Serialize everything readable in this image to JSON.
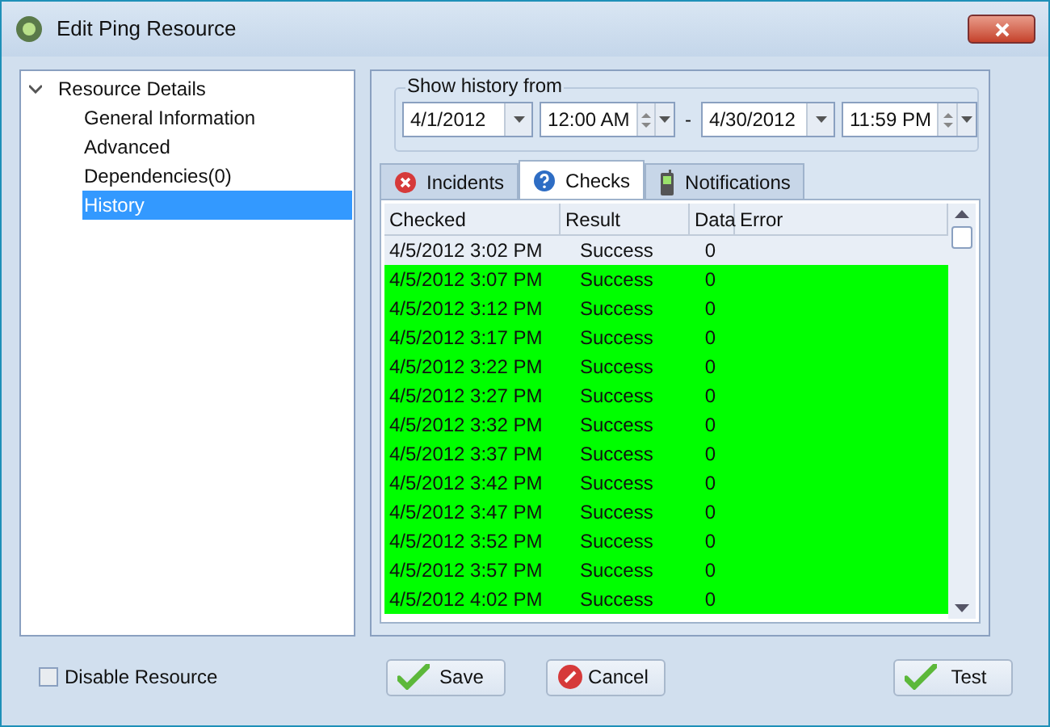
{
  "window": {
    "title": "Edit Ping Resource"
  },
  "tree": {
    "label": "Resource Details",
    "expanded": true,
    "children": [
      {
        "label": "General Information",
        "selected": false
      },
      {
        "label": "Advanced",
        "selected": false
      },
      {
        "label": "Dependencies(0)",
        "selected": false
      },
      {
        "label": "History",
        "selected": true
      }
    ]
  },
  "history_filter": {
    "title": "Show history from",
    "from_date": "4/1/2012",
    "from_time": "12:00 AM",
    "separator": "-",
    "to_date": "4/30/2012",
    "to_time": "11:59 PM"
  },
  "tabs": [
    {
      "label": "Incidents",
      "kind": "error",
      "selected": false
    },
    {
      "label": "Checks",
      "kind": "help",
      "selected": true
    },
    {
      "label": "Notifications",
      "kind": "phone",
      "selected": false
    }
  ],
  "table": {
    "columns": [
      "Checked",
      "Result",
      "Data",
      "Error"
    ],
    "rows": [
      {
        "checked": "4/5/2012 3:02 PM",
        "result": "Success",
        "data": "0",
        "selected": true
      },
      {
        "checked": "4/5/2012 3:07 PM",
        "result": "Success",
        "data": "0",
        "selected": false
      },
      {
        "checked": "4/5/2012 3:12 PM",
        "result": "Success",
        "data": "0",
        "selected": false
      },
      {
        "checked": "4/5/2012 3:17 PM",
        "result": "Success",
        "data": "0",
        "selected": false
      },
      {
        "checked": "4/5/2012 3:22 PM",
        "result": "Success",
        "data": "0",
        "selected": false
      },
      {
        "checked": "4/5/2012 3:27 PM",
        "result": "Success",
        "data": "0",
        "selected": false
      },
      {
        "checked": "4/5/2012 3:32 PM",
        "result": "Success",
        "data": "0",
        "selected": false
      },
      {
        "checked": "4/5/2012 3:37 PM",
        "result": "Success",
        "data": "0",
        "selected": false
      },
      {
        "checked": "4/5/2012 3:42 PM",
        "result": "Success",
        "data": "0",
        "selected": false
      },
      {
        "checked": "4/5/2012 3:47 PM",
        "result": "Success",
        "data": "0",
        "selected": false
      },
      {
        "checked": "4/5/2012 3:52 PM",
        "result": "Success",
        "data": "0",
        "selected": false
      },
      {
        "checked": "4/5/2012 3:57 PM",
        "result": "Success",
        "data": "0",
        "selected": false
      },
      {
        "checked": "4/5/2012 4:02 PM",
        "result": "Success",
        "data": "0",
        "selected": false
      }
    ]
  },
  "disable_resource": {
    "label": "Disable Resource",
    "checked": false
  },
  "buttons": [
    {
      "label": "Save",
      "kind": "ok"
    },
    {
      "label": "Cancel",
      "kind": "cancel"
    },
    {
      "label": "Test",
      "kind": "ok"
    }
  ]
}
